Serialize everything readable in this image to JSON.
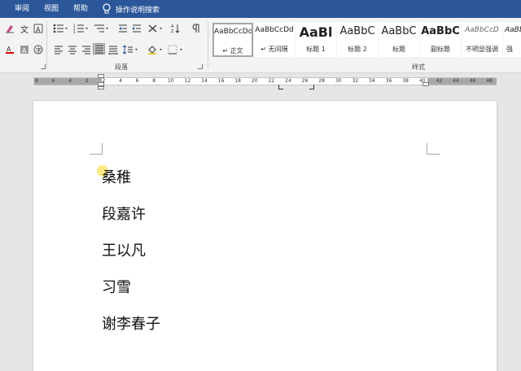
{
  "tabs": [
    "审阅",
    "视图",
    "帮助"
  ],
  "tell_me": "操作说明搜索",
  "groups": {
    "paragraph": "段落",
    "styles": "样式"
  },
  "style_gallery": [
    {
      "preview": "AaBbCcDd",
      "name": "↵ 正文",
      "selected": true
    },
    {
      "preview": "AaBbCcDd",
      "name": "↵ 无间隔"
    },
    {
      "preview": "AaBl",
      "name": "标题 1"
    },
    {
      "preview": "AaBbC",
      "name": "标题 2"
    },
    {
      "preview": "AaBbC",
      "name": "标题"
    },
    {
      "preview": "AaBbC",
      "name": "副标题"
    },
    {
      "preview": "AaBbCcD",
      "name": "不明显强调"
    },
    {
      "preview": "AaBb",
      "name": "强"
    }
  ],
  "ruler_labels": [
    "8",
    "6",
    "4",
    "2",
    "2",
    "4",
    "6",
    "8",
    "10",
    "12",
    "14",
    "16",
    "18",
    "20",
    "22",
    "24",
    "26",
    "28",
    "30",
    "32",
    "34",
    "36",
    "38",
    "40",
    "42",
    "44",
    "46",
    "48"
  ],
  "document": {
    "lines": [
      "桑稚",
      "段嘉许",
      "王以凡",
      "习雪",
      "谢李春子"
    ]
  }
}
